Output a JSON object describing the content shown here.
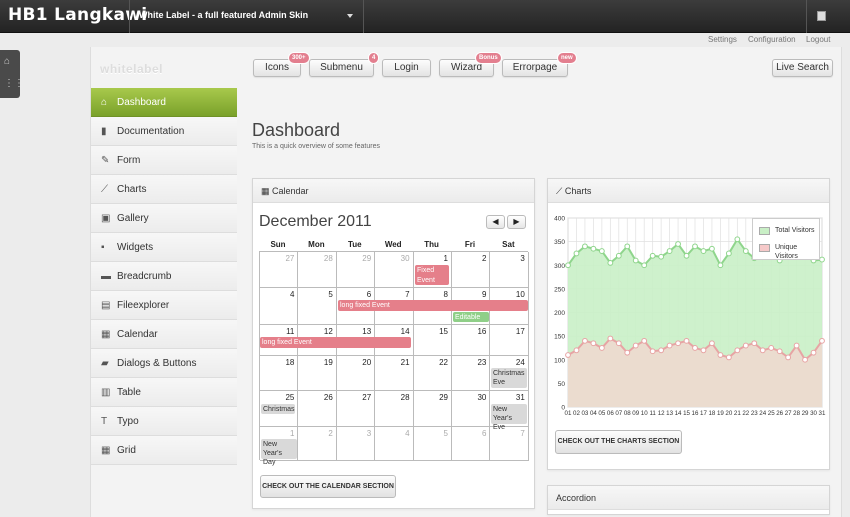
{
  "topbar": {
    "brand": "HB1 Langkawi",
    "theme_label": "White Label - a full featured Admin Skin",
    "links": [
      "Settings",
      "Configuration",
      "Logout"
    ]
  },
  "header": {
    "logo": "whitelabel",
    "nav_buttons": [
      {
        "label": "Icons",
        "badge": "300+"
      },
      {
        "label": "Submenu",
        "badge": "4"
      },
      {
        "label": "Login",
        "badge": ""
      },
      {
        "label": "Wizard",
        "badge": "Bonus"
      },
      {
        "label": "Errorpage",
        "badge": "new"
      }
    ],
    "search_button": "Live Search"
  },
  "sidebar": {
    "items": [
      {
        "label": "Dashboard",
        "icon": "home-icon",
        "glyph": "⌂",
        "active": true
      },
      {
        "label": "Documentation",
        "icon": "book-icon",
        "glyph": "▮",
        "active": false
      },
      {
        "label": "Form",
        "icon": "edit-icon",
        "glyph": "✎",
        "active": false
      },
      {
        "label": "Charts",
        "icon": "chart-icon",
        "glyph": "⟋",
        "active": false
      },
      {
        "label": "Gallery",
        "icon": "image-icon",
        "glyph": "▣",
        "active": false
      },
      {
        "label": "Widgets",
        "icon": "widgets-icon",
        "glyph": "▪",
        "active": false
      },
      {
        "label": "Breadcrumb",
        "icon": "breadcrumb-icon",
        "glyph": "▬",
        "active": false
      },
      {
        "label": "Fileexplorer",
        "icon": "folder-icon",
        "glyph": "▤",
        "active": false
      },
      {
        "label": "Calendar",
        "icon": "calendar-icon",
        "glyph": "▦",
        "active": false
      },
      {
        "label": "Dialogs & Buttons",
        "icon": "dialog-icon",
        "glyph": "▰",
        "active": false
      },
      {
        "label": "Table",
        "icon": "table-icon",
        "glyph": "▥",
        "active": false
      },
      {
        "label": "Typo",
        "icon": "typography-icon",
        "glyph": "T",
        "active": false
      },
      {
        "label": "Grid",
        "icon": "grid-icon",
        "glyph": "▦",
        "active": false
      }
    ]
  },
  "main": {
    "title": "Dashboard",
    "subtitle": "This is a quick overview of some features"
  },
  "calendar": {
    "header": "Calendar",
    "month": "December 2011",
    "weekdays": [
      "Sun",
      "Mon",
      "Tue",
      "Wed",
      "Thu",
      "Fri",
      "Sat"
    ],
    "weeks": [
      [
        {
          "d": "27",
          "o": true
        },
        {
          "d": "28",
          "o": true
        },
        {
          "d": "29",
          "o": true
        },
        {
          "d": "30",
          "o": true
        },
        {
          "d": "1"
        },
        {
          "d": "2"
        },
        {
          "d": "3"
        }
      ],
      [
        {
          "d": "4"
        },
        {
          "d": "5"
        },
        {
          "d": "6"
        },
        {
          "d": "7"
        },
        {
          "d": "8"
        },
        {
          "d": "9"
        },
        {
          "d": "10"
        }
      ],
      [
        {
          "d": "11"
        },
        {
          "d": "12"
        },
        {
          "d": "13"
        },
        {
          "d": "14"
        },
        {
          "d": "15"
        },
        {
          "d": "16"
        },
        {
          "d": "17"
        }
      ],
      [
        {
          "d": "18"
        },
        {
          "d": "19"
        },
        {
          "d": "20"
        },
        {
          "d": "21"
        },
        {
          "d": "22"
        },
        {
          "d": "23"
        },
        {
          "d": "24"
        }
      ],
      [
        {
          "d": "25"
        },
        {
          "d": "26"
        },
        {
          "d": "27"
        },
        {
          "d": "28"
        },
        {
          "d": "29"
        },
        {
          "d": "30"
        },
        {
          "d": "31"
        }
      ],
      [
        {
          "d": "1",
          "o": true
        },
        {
          "d": "2",
          "o": true
        },
        {
          "d": "3",
          "o": true
        },
        {
          "d": "4",
          "o": true
        },
        {
          "d": "5",
          "o": true
        },
        {
          "d": "6",
          "o": true
        },
        {
          "d": "7",
          "o": true
        }
      ]
    ],
    "events": {
      "fixed": "Fixed Event",
      "long1": "long fixed Event",
      "editable": "Editable",
      "long2": "long fixed Event",
      "christmas_eve": "Christmas Eve",
      "christmas": "Christmas",
      "new_years_eve": "New Year's Eve",
      "new_years_day": "New Year's Day"
    },
    "button": "CHECK OUT THE CALENDAR SECTION"
  },
  "charts": {
    "header": "Charts",
    "button": "CHECK OUT THE CHARTS SECTION"
  },
  "accordion": {
    "header": "Accordion"
  },
  "chart_data": {
    "type": "area",
    "x": [
      "01",
      "02",
      "03",
      "04",
      "05",
      "06",
      "07",
      "08",
      "09",
      "10",
      "11",
      "12",
      "13",
      "14",
      "15",
      "16",
      "17",
      "18",
      "19",
      "20",
      "21",
      "22",
      "23",
      "24",
      "25",
      "26",
      "27",
      "28",
      "29",
      "30",
      "31"
    ],
    "ylim": [
      0,
      400
    ],
    "yticks": [
      0,
      50,
      100,
      150,
      200,
      250,
      300,
      350,
      400
    ],
    "legend": "top-right",
    "grid": true,
    "series": [
      {
        "name": "Total Visitors",
        "color": "#9cd99a",
        "values": [
          300,
          325,
          340,
          335,
          330,
          305,
          320,
          340,
          310,
          300,
          320,
          318,
          330,
          345,
          320,
          340,
          330,
          335,
          300,
          325,
          355,
          330,
          315,
          350,
          320,
          310,
          325,
          345,
          318,
          310,
          312
        ]
      },
      {
        "name": "Unique Visitors",
        "color": "#e8a3a3",
        "values": [
          110,
          120,
          140,
          135,
          125,
          145,
          135,
          115,
          130,
          140,
          118,
          120,
          130,
          135,
          140,
          125,
          120,
          135,
          110,
          105,
          120,
          130,
          135,
          120,
          125,
          118,
          105,
          130,
          100,
          115,
          140
        ]
      }
    ]
  }
}
